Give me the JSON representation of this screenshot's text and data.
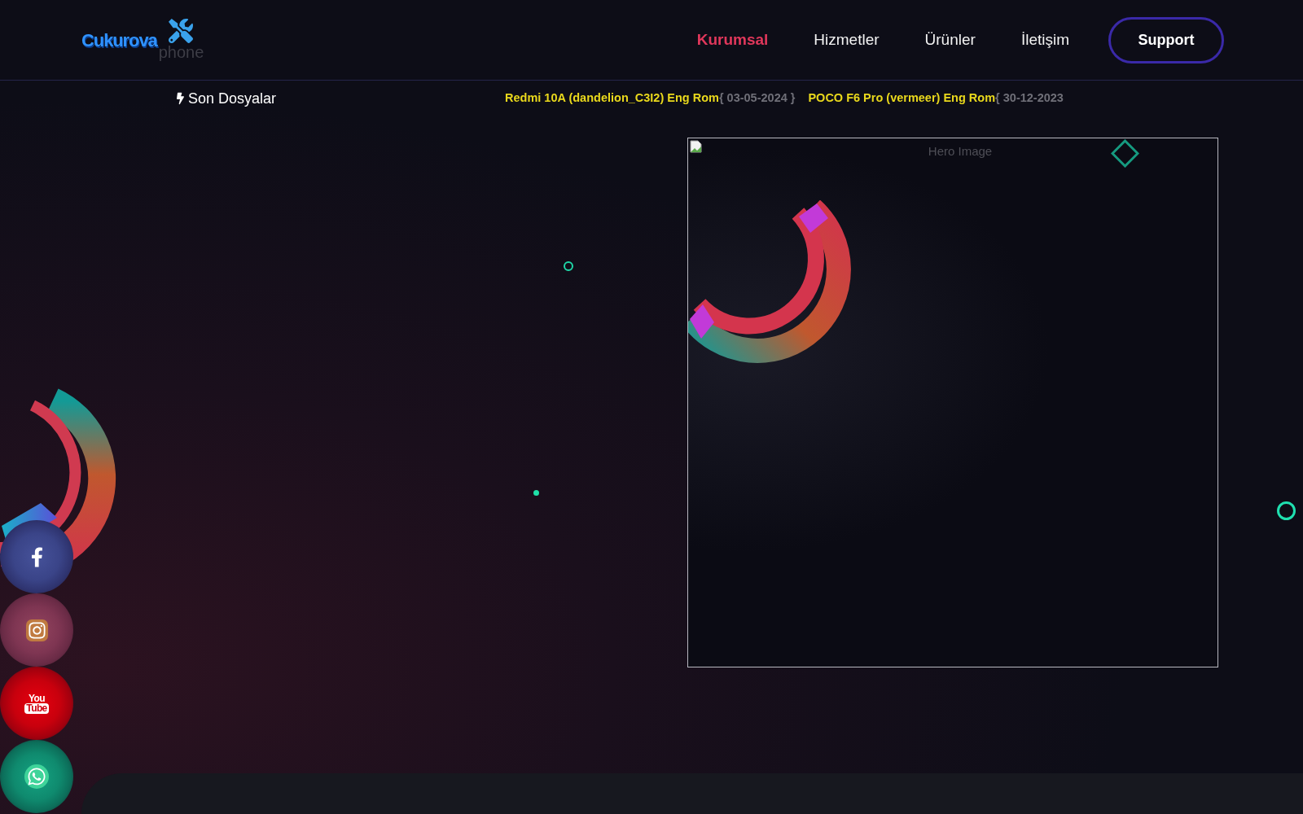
{
  "header": {
    "logo": {
      "wordmark": "Cukurova",
      "subtext": "phone"
    },
    "nav": [
      {
        "label": "Kurumsal",
        "selected": true
      },
      {
        "label": "Hizmetler",
        "selected": false
      },
      {
        "label": "Ürünler",
        "selected": false
      },
      {
        "label": "İletişim",
        "selected": false
      }
    ],
    "support_button": "Support"
  },
  "ticker": {
    "title": "Son Dosyalar",
    "items": [
      {
        "name": "Redmi 10A (dandelion_C3I2) Eng Rom",
        "date": "{ 03-05-2024 }"
      },
      {
        "name": "POCO F6 Pro (vermeer) Eng Rom",
        "date": "{ 30-12-2023"
      }
    ]
  },
  "hero": {
    "image_alt": "Hero Image"
  },
  "social": [
    {
      "kind": "facebook"
    },
    {
      "kind": "instagram"
    },
    {
      "kind": "youtube",
      "logo_top": "You",
      "logo_bottom": "Tube"
    },
    {
      "kind": "whatsapp"
    }
  ]
}
